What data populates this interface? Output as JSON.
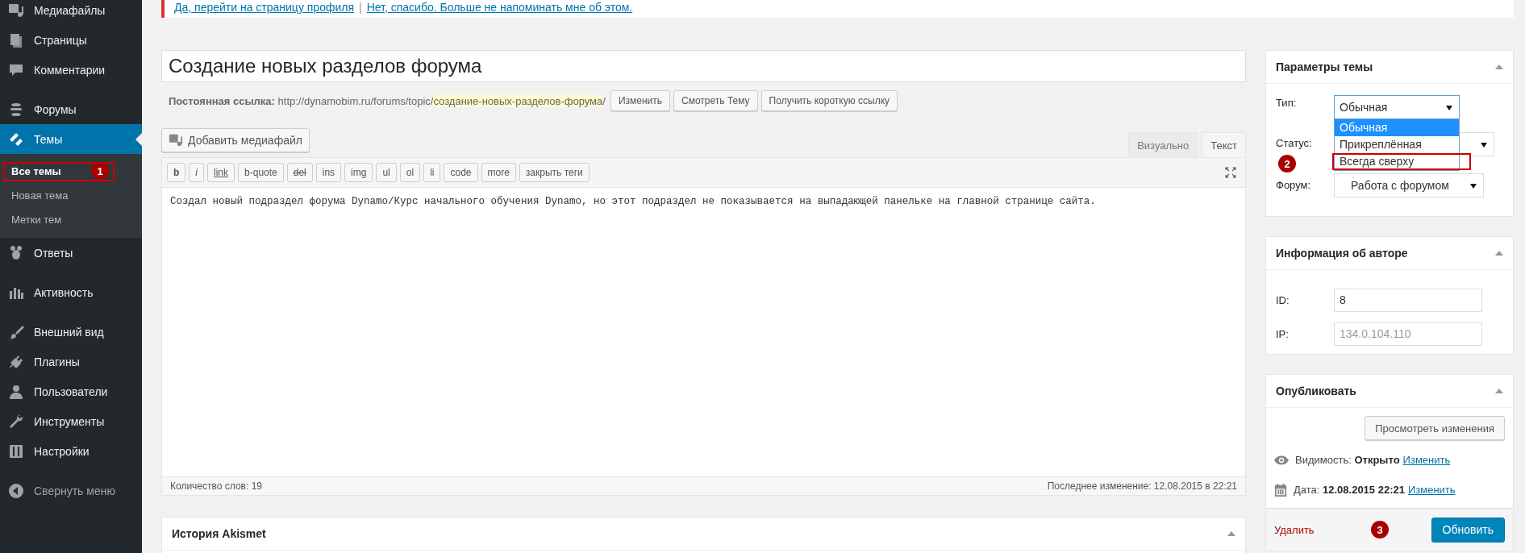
{
  "sidebar": {
    "groups": [
      [
        {
          "label": "Медиафайлы",
          "selected": false
        },
        {
          "label": "Страницы",
          "selected": false
        },
        {
          "label": "Комментарии",
          "selected": false
        }
      ],
      [
        {
          "label": "Форумы",
          "selected": false
        },
        {
          "label": "Темы",
          "selected": true,
          "children": [
            {
              "label": "Все темы",
              "selected": true,
              "marker": "1"
            },
            {
              "label": "Новая тема",
              "selected": false
            },
            {
              "label": "Метки тем",
              "selected": false
            }
          ]
        },
        {
          "label": "Ответы",
          "selected": false
        }
      ],
      [
        {
          "label": "Активность",
          "selected": false
        }
      ],
      [
        {
          "label": "Внешний вид",
          "selected": false
        },
        {
          "label": "Плагины",
          "selected": false
        },
        {
          "label": "Пользователи",
          "selected": false
        },
        {
          "label": "Инструменты",
          "selected": false
        },
        {
          "label": "Настройки",
          "selected": false
        }
      ]
    ],
    "collapse": "Свернуть меню"
  },
  "notice": {
    "links": [
      "Да, перейти на страницу профиля",
      "Нет, спасибо. Больше не напоминать мне об этом."
    ],
    "separator": "|"
  },
  "title": "Создание новых разделов форума",
  "permalink": {
    "label": "Постоянная ссылка:",
    "base": "http://dynamobim.ru/forums/topic/",
    "slug": "создание-новых-разделов-форума",
    "suffix": "/",
    "buttons": [
      "Изменить",
      "Смотреть Тему",
      "Получить короткую ссылку"
    ]
  },
  "editor": {
    "add_media": "Добавить медиафайл",
    "tabs": [
      {
        "label": "Визуально",
        "selected": false
      },
      {
        "label": "Текст",
        "selected": true
      }
    ],
    "quicktags": [
      {
        "label": "b",
        "kind": "bold"
      },
      {
        "label": "i",
        "kind": "italic"
      },
      {
        "label": "link",
        "kind": "underline"
      },
      {
        "label": "b-quote",
        "kind": "plain"
      },
      {
        "label": "del",
        "kind": "strike"
      },
      {
        "label": "ins",
        "kind": "plain"
      },
      {
        "label": "img",
        "kind": "plain"
      },
      {
        "label": "ul",
        "kind": "plain"
      },
      {
        "label": "ol",
        "kind": "plain"
      },
      {
        "label": "li",
        "kind": "plain"
      },
      {
        "label": "code",
        "kind": "plain"
      },
      {
        "label": "more",
        "kind": "plain"
      },
      {
        "label": "закрыть теги",
        "kind": "plain"
      }
    ],
    "content": "Создал новый подраздел форума Dynamo/Курс начального обучения Dynamo, но этот подраздел не показывается на выпадающей панельке на главной странице сайта.",
    "word_count": "Количество слов: 19",
    "last_edit": "Последнее изменение: 12.08.2015 в 22:21"
  },
  "akismet": {
    "title": "История Akismet"
  },
  "topic_params": {
    "title": "Параметры темы",
    "type": {
      "label": "Тип:",
      "value": "Обычная",
      "options": [
        {
          "label": "Обычная",
          "selected": true
        },
        {
          "label": "Прикреплённая",
          "selected": false
        },
        {
          "label": "Всегда сверху",
          "selected": false,
          "marker": "2"
        }
      ]
    },
    "status": {
      "label": "Статус:"
    },
    "forum": {
      "label": "Форум:",
      "value": "Работа с форумом"
    }
  },
  "author": {
    "title": "Информация об авторе",
    "fields": [
      {
        "label": "ID:",
        "value": "8",
        "disabled": false
      },
      {
        "label": "IP:",
        "value": "134.0.104.110",
        "disabled": true
      }
    ]
  },
  "publish": {
    "title": "Опубликовать",
    "preview": "Просмотреть изменения",
    "visibility": {
      "label": "Видимость:",
      "value": "Открыто",
      "link": "Изменить"
    },
    "date": {
      "label": "Дата:",
      "value": "12.08.2015 22:21",
      "link": "Изменить"
    },
    "delete": "Удалить",
    "update": "Обновить",
    "marker": "3"
  }
}
